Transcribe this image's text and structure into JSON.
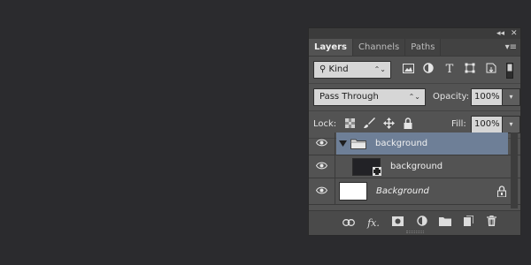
{
  "panel": {
    "collapse_label": "◂◂",
    "close_label": "✕",
    "tabs": [
      {
        "label": "Layers"
      },
      {
        "label": "Channels"
      },
      {
        "label": "Paths"
      }
    ],
    "menu_label": "▾≡"
  },
  "filter": {
    "kind_label": "Kind",
    "arrow": "⌃⌄"
  },
  "blend": {
    "mode": "Pass Through",
    "opacity_label": "Opacity:",
    "opacity_value": "100%"
  },
  "lock": {
    "label": "Lock:",
    "fill_label": "Fill:",
    "fill_value": "100%"
  },
  "layers": [
    {
      "name": "background",
      "type": "group",
      "selected": true
    },
    {
      "name": "background",
      "type": "smart-object"
    },
    {
      "name": "Background",
      "type": "background",
      "locked": true
    }
  ],
  "colors": {
    "panel_bg": "#535353",
    "selection": "#6e7f97",
    "app_bg": "#2b2b2e"
  }
}
